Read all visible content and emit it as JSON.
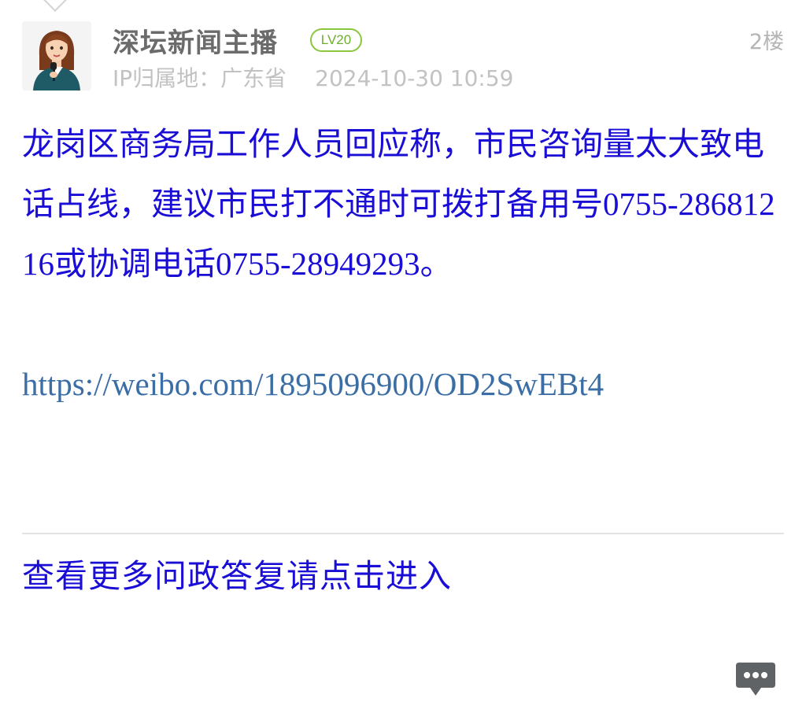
{
  "post": {
    "author": {
      "name": "深坛新闻主播",
      "level": "LV20",
      "avatar_icon": "anchor-avatar-icon"
    },
    "floor": "2楼",
    "ip_location": "IP归属地：广东省",
    "timestamp": "2024-10-30 10:59",
    "content": {
      "part1": "龙岗区商务局工作人员回应称，市民咨询量太大致电话占线，建议市民打不通时可拨打备用号",
      "phone1": "0755-28681216",
      "part2": "或协调电话",
      "phone2": "0755-28949293",
      "part3": "。"
    },
    "link": "https://weibo.com/1895096900/OD2SwEBt4",
    "more_link_label": "查看更多问政答复请点击进入"
  },
  "colors": {
    "content_text": "#1a0dd6",
    "link_text": "#3a6ea5",
    "author_name": "#6b6b6b",
    "meta_text": "#c2c2c2",
    "level_badge": "#8cc63f",
    "chat_button": "#5f6366"
  },
  "icons": {
    "chat_button": "chat-bubble-icon"
  }
}
